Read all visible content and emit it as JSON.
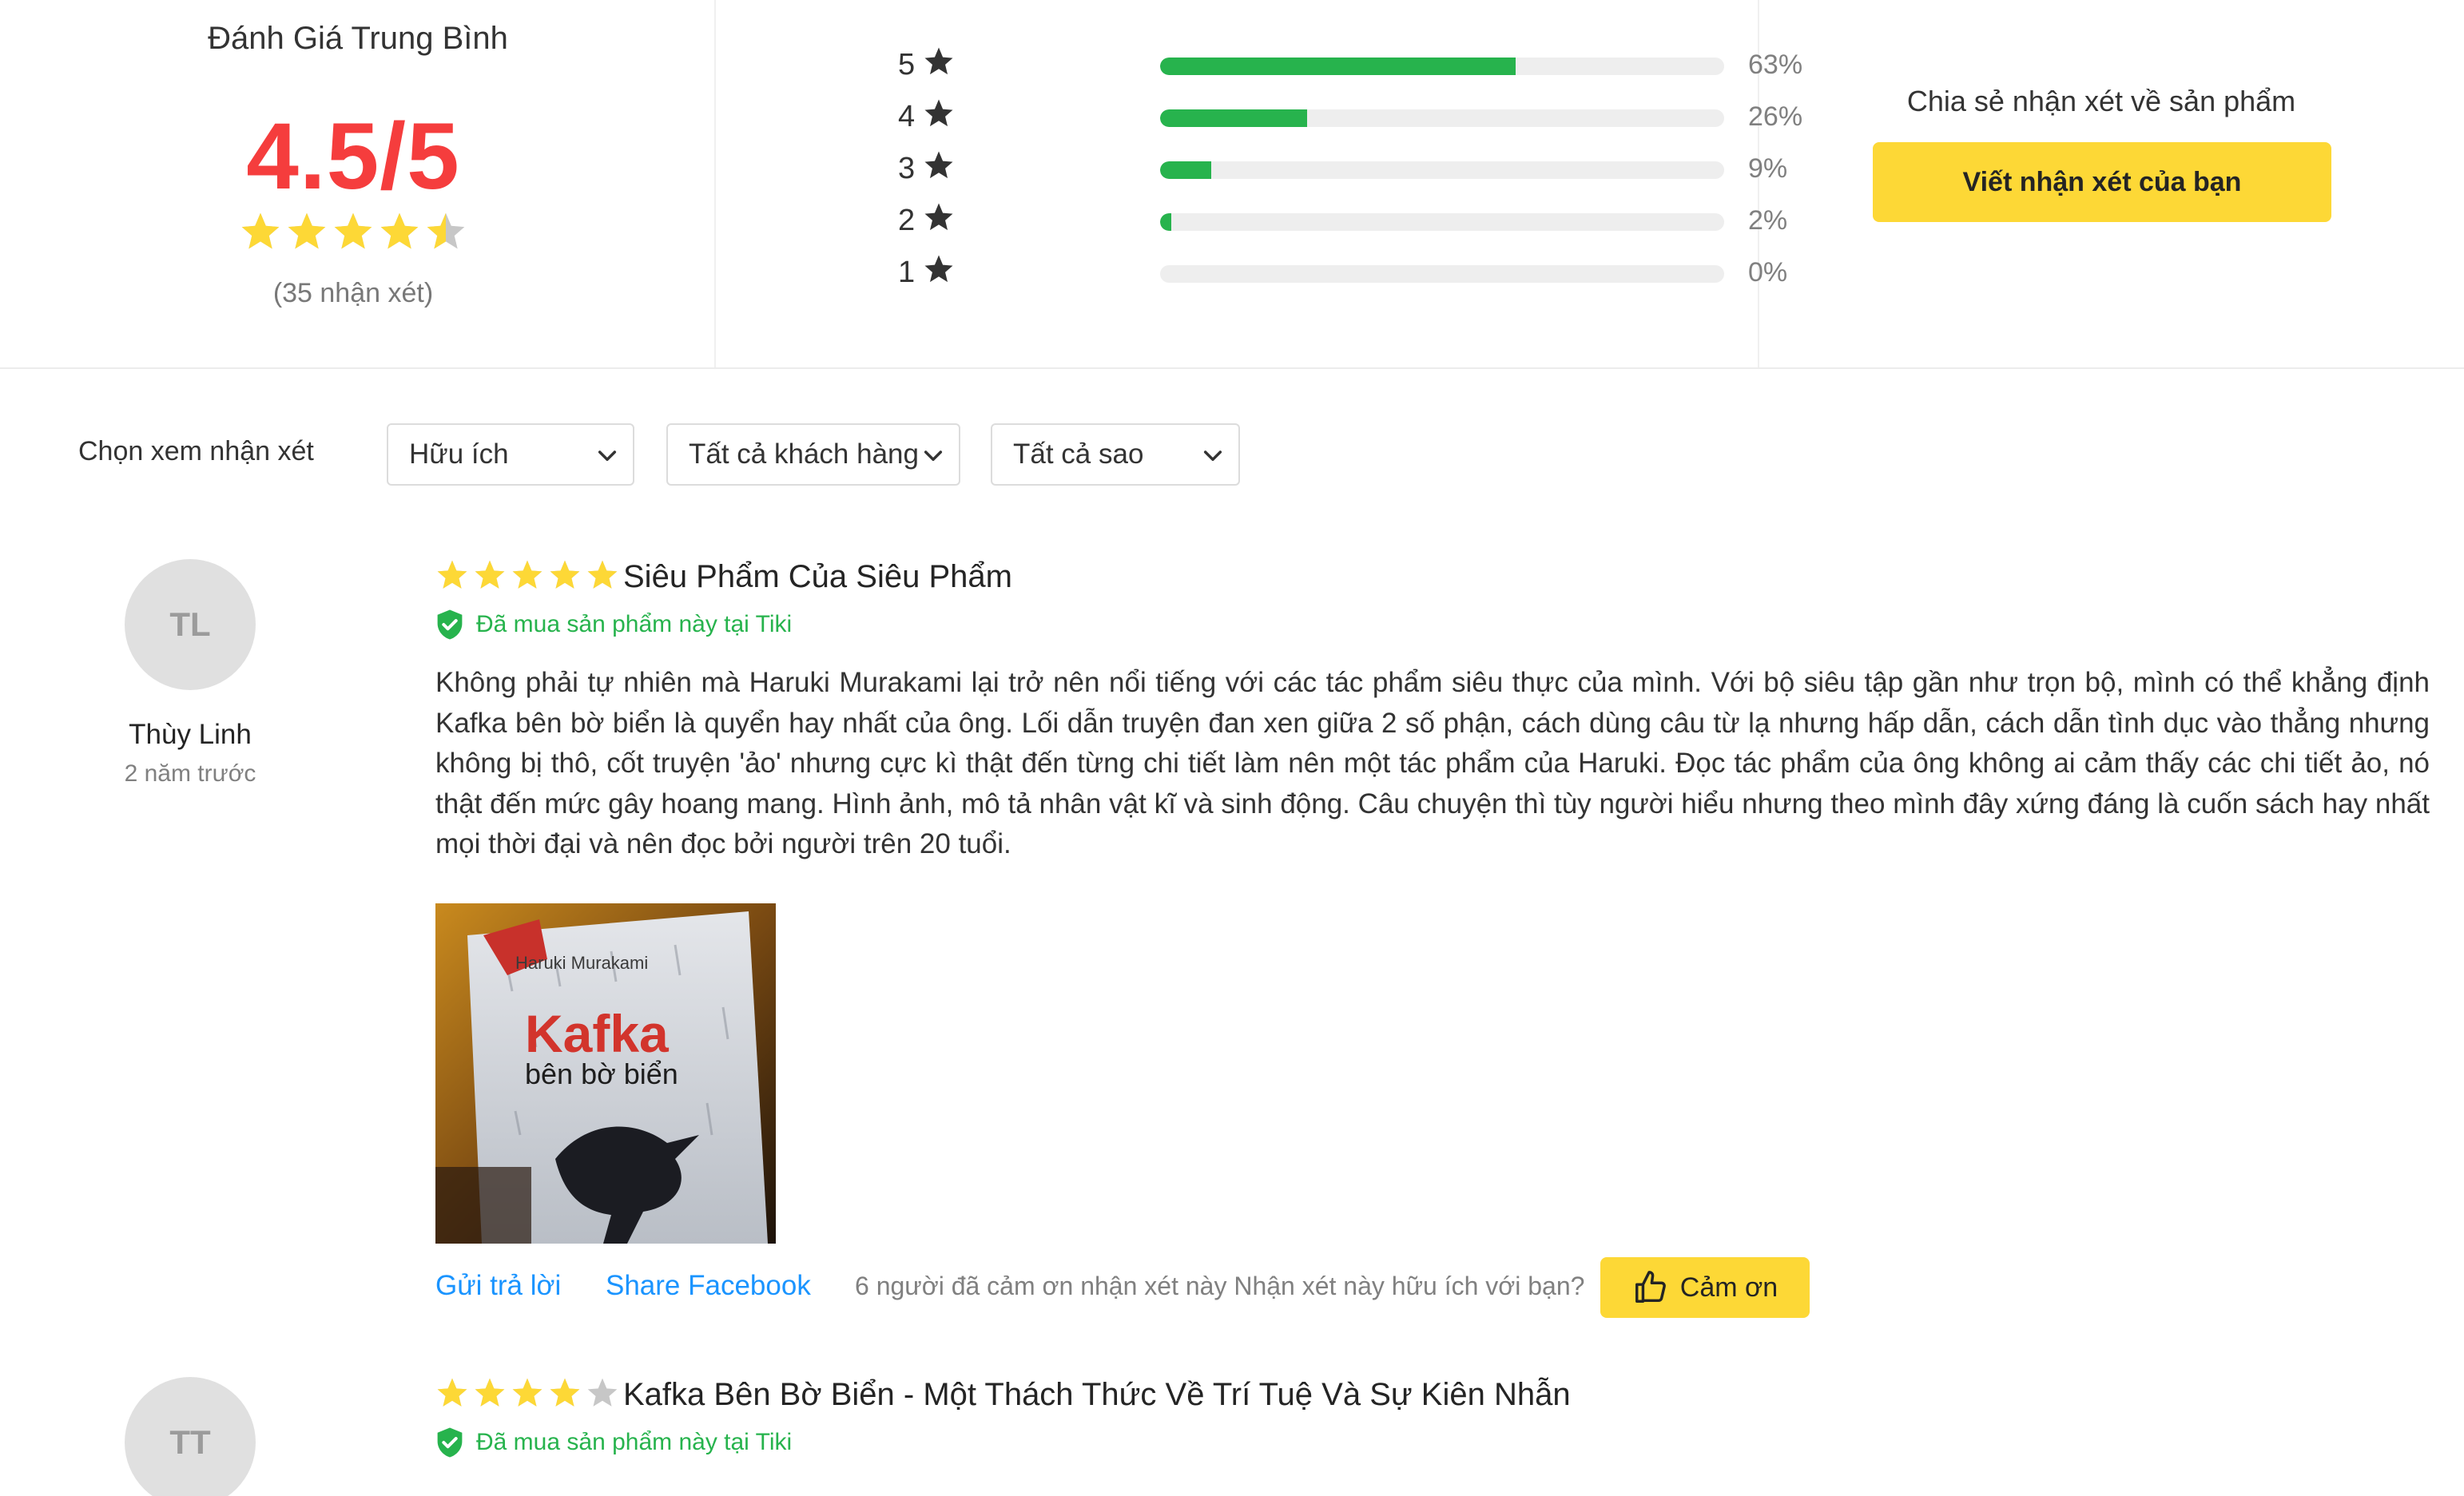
{
  "summary": {
    "title": "Đánh Giá Trung Bình",
    "score": "4.5/5",
    "rating": 4.5,
    "count_text": "(35 nhận xét)",
    "bars": [
      {
        "stars": "5",
        "percent": 63,
        "label": "63%"
      },
      {
        "stars": "4",
        "percent": 26,
        "label": "26%"
      },
      {
        "stars": "3",
        "percent": 9,
        "label": "9%"
      },
      {
        "stars": "2",
        "percent": 2,
        "label": "2%"
      },
      {
        "stars": "1",
        "percent": 0,
        "label": "0%"
      }
    ],
    "share_label": "Chia sẻ nhận xét về sản phẩm",
    "share_button": "Viết nhận xét của bạn"
  },
  "filters": {
    "label": "Chọn xem nhận xét",
    "sort": "Hữu ích",
    "customers": "Tất cả khách hàng",
    "stars": "Tất cả sao"
  },
  "reviews": [
    {
      "initials": "TL",
      "name": "Thùy Linh",
      "time": "2 năm trước",
      "rating": 5,
      "title": "Siêu Phẩm Của Siêu Phẩm",
      "verified": "Đã mua sản phẩm này tại Tiki",
      "body": "Không phải tự nhiên mà Haruki Murakami lại trở nên nổi tiếng với các tác phẩm siêu thực của mình. Với bộ siêu tập gần như trọn bộ, mình có thể khẳng định Kafka bên bờ biển là quyển hay nhất của ông. Lối dẫn truyện đan xen giữa 2 số phận, cách dùng câu từ lạ nhưng hấp dẫn, cách dẫn tình dục vào thẳng nhưng không bị thô, cốt truyện 'ảo' nhưng cực kì thật đến từng chi tiết làm nên một tác phẩm của Haruki. Đọc tác phẩm của ông không ai cảm thấy các chi tiết ảo, nó thật đến mức gây hoang mang. Hình ảnh, mô tả nhân vật kĩ và sinh động. Câu chuyện thì tùy người hiểu nhưng theo mình đây xứng đáng là cuốn sách hay nhất mọi thời đại và nên đọc bởi người trên 20 tuổi.",
      "photo": {
        "author": "Haruki Murakami",
        "book_title": "Kafka",
        "book_subtitle": "bên bờ biển"
      },
      "reply": "Gửi trả lời",
      "share": "Share Facebook",
      "thanks_text": "6 người đã cảm ơn nhận xét này Nhận xét này hữu ích với bạn?",
      "thanks_button": "Cảm ơn"
    },
    {
      "initials": "TT",
      "rating": 4,
      "title": "Kafka Bên Bờ Biển - Một Thách Thức Về Trí Tuệ Và Sự Kiên Nhẫn",
      "verified": "Đã mua sản phẩm này tại Tiki"
    }
  ],
  "colors": {
    "accent_yellow": "#fdd836",
    "star_gold": "#fdd836",
    "score_red": "#f53d3d",
    "bar_green": "#27b34d",
    "link_blue": "#1a94ff",
    "verified_green": "#27b34d"
  }
}
